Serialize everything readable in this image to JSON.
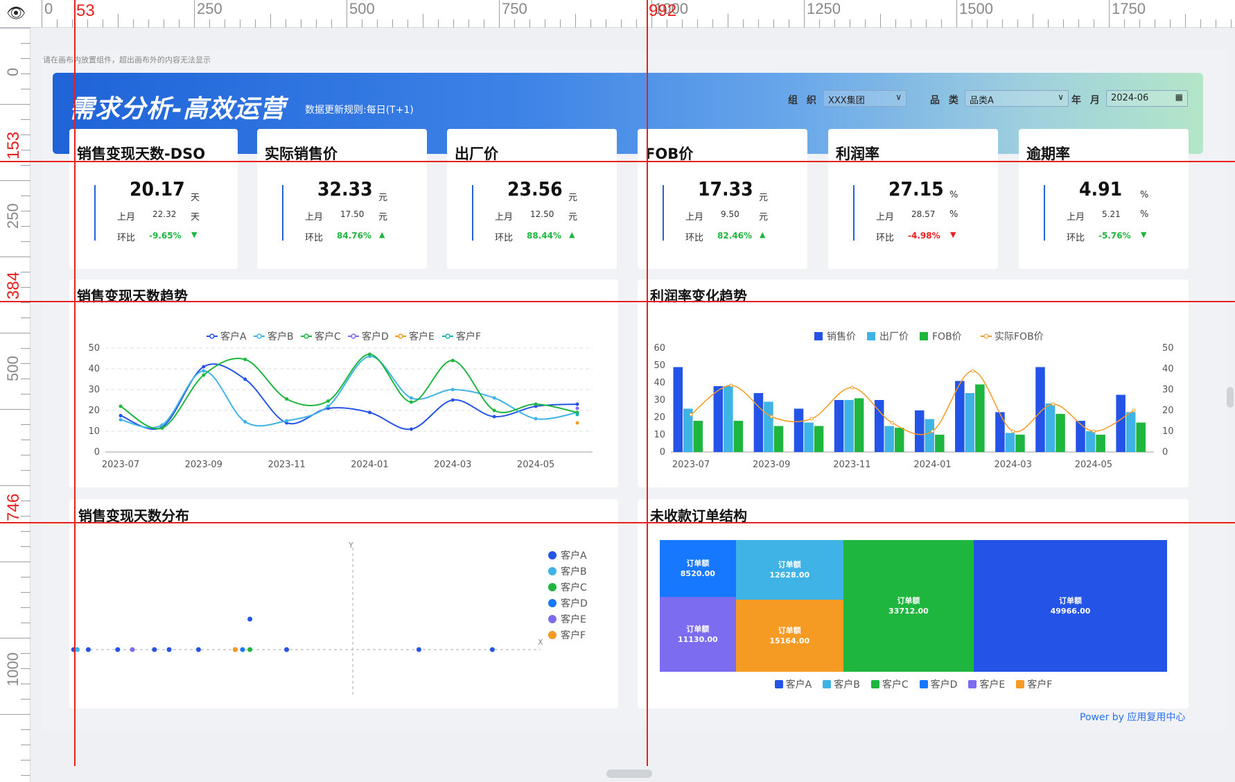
{
  "ruler": {
    "top_labels": [
      "0",
      "250",
      "500",
      "750",
      "1000",
      "1250",
      "1500",
      "1750"
    ],
    "left_labels": [
      "0",
      "250",
      "500",
      "1000"
    ],
    "guides_v": [
      "53",
      "992"
    ],
    "guides_h": [
      "153",
      "384",
      "746"
    ]
  },
  "canvas_note": "请在画布内放置组件，超出画布外的内容无法显示",
  "banner": {
    "title": "需求分析-高效运营",
    "subtitle": "数据更新规则:每日(T+1)",
    "filters": [
      {
        "label": "组 织",
        "value": "XXX集团",
        "control": "select"
      },
      {
        "label": "品 类",
        "value": "品类A",
        "control": "select"
      },
      {
        "label": "年 月",
        "value": "2024-06",
        "control": "date"
      }
    ]
  },
  "kpis": [
    {
      "title": "销售变现天数-DSO",
      "value": "20.17",
      "unit": "天",
      "prev_label": "上月",
      "prev": "22.32",
      "prev_unit": "天",
      "chg_label": "环比",
      "chg": "-9.65%",
      "direction": "down",
      "color": "#1fb640"
    },
    {
      "title": "实际销售价",
      "value": "32.33",
      "unit": "元",
      "prev_label": "上月",
      "prev": "17.50",
      "prev_unit": "元",
      "chg_label": "环比",
      "chg": "84.76%",
      "direction": "up",
      "color": "#1fb640"
    },
    {
      "title": "出厂价",
      "value": "23.56",
      "unit": "元",
      "prev_label": "上月",
      "prev": "12.50",
      "prev_unit": "元",
      "chg_label": "环比",
      "chg": "88.44%",
      "direction": "up",
      "color": "#1fb640"
    },
    {
      "title": "FOB价",
      "value": "17.33",
      "unit": "元",
      "prev_label": "上月",
      "prev": "9.50",
      "prev_unit": "元",
      "chg_label": "环比",
      "chg": "82.46%",
      "direction": "up",
      "color": "#1fb640"
    },
    {
      "title": "利润率",
      "value": "27.15",
      "unit": "%",
      "prev_label": "上月",
      "prev": "28.57",
      "prev_unit": "%",
      "chg_label": "环比",
      "chg": "-4.98%",
      "direction": "down",
      "color": "#e8201d"
    },
    {
      "title": "逾期率",
      "value": "4.91",
      "unit": "%",
      "prev_label": "上月",
      "prev": "5.21",
      "prev_unit": "%",
      "chg_label": "环比",
      "chg": "-5.76%",
      "direction": "down",
      "color": "#1fb640"
    }
  ],
  "panels": {
    "trend_dso": "销售变现天数趋势",
    "trend_profit": "利润率变化趋势",
    "dist": "销售变现天数分布",
    "structure": "未收款订单结构"
  },
  "powered_by": "Power by 应用复用中心",
  "chart_data": [
    {
      "type": "line",
      "title": "销售变现天数趋势",
      "x": [
        "2023-07",
        "2023-08",
        "2023-09",
        "2023-10",
        "2023-11",
        "2023-12",
        "2024-01",
        "2024-02",
        "2024-03",
        "2024-04",
        "2024-05",
        "2024-06"
      ],
      "x_ticks": [
        "2023-07",
        "2023-09",
        "2023-11",
        "2024-01",
        "2024-03",
        "2024-05"
      ],
      "ylim": [
        0,
        50
      ],
      "y_ticks": [
        "0",
        "10",
        "20",
        "30",
        "40",
        "50"
      ],
      "legend_position": "top",
      "colors": [
        "#2453e8",
        "#3fb2e6",
        "#1fb640",
        "#7b6cf0",
        "#f59a23",
        "#13b5b1"
      ],
      "series": [
        {
          "name": "客户A",
          "values": [
            17.5,
            12,
            41,
            35,
            14,
            21,
            19,
            11,
            25,
            17,
            22,
            23
          ]
        },
        {
          "name": "客户B",
          "values": [
            15.5,
            13,
            39,
            14.5,
            15,
            22,
            46,
            26,
            30,
            26,
            16,
            19
          ]
        },
        {
          "name": "客户C",
          "values": [
            22,
            11.5,
            37,
            44.5,
            25.5,
            24.5,
            47,
            24,
            44,
            20,
            23,
            19
          ]
        },
        {
          "name": "客户D",
          "values": [
            null,
            null,
            null,
            null,
            null,
            null,
            null,
            null,
            null,
            null,
            null,
            21
          ]
        },
        {
          "name": "客户E",
          "values": [
            null,
            null,
            null,
            null,
            null,
            null,
            null,
            null,
            null,
            null,
            null,
            14
          ]
        },
        {
          "name": "客户F",
          "values": [
            null,
            null,
            null,
            null,
            null,
            null,
            null,
            null,
            null,
            null,
            null,
            18
          ]
        }
      ]
    },
    {
      "type": "bar",
      "title": "利润率变化趋势",
      "x": [
        "2023-07",
        "2023-08",
        "2023-09",
        "2023-10",
        "2023-11",
        "2023-12",
        "2024-01",
        "2024-02",
        "2024-03",
        "2024-04",
        "2024-05",
        "2024-06"
      ],
      "x_ticks": [
        "2023-07",
        "2023-09",
        "2023-11",
        "2024-01",
        "2024-03",
        "2024-05"
      ],
      "ylim_left": [
        0,
        60
      ],
      "y_ticks_left": [
        "0",
        "10",
        "20",
        "30",
        "40",
        "50",
        "60"
      ],
      "ylim_right": [
        0,
        50
      ],
      "y_ticks_right": [
        "0",
        "10",
        "20",
        "30",
        "40",
        "50"
      ],
      "legend_position": "top",
      "colors": [
        "#2453e8",
        "#3fb2e6",
        "#1fb640",
        "#f59a23"
      ],
      "series": [
        {
          "name": "销售价",
          "kind": "bar",
          "values": [
            49,
            38,
            34,
            25,
            30,
            30,
            24,
            41,
            23,
            49,
            18,
            33
          ]
        },
        {
          "name": "出厂价",
          "kind": "bar",
          "values": [
            25,
            38,
            29,
            17,
            30,
            15,
            19,
            34,
            11,
            28,
            12,
            23
          ]
        },
        {
          "name": "FOB价",
          "kind": "bar",
          "values": [
            18,
            18,
            15,
            15,
            31,
            14,
            10,
            39,
            10,
            22,
            10,
            17
          ]
        },
        {
          "name": "实际FOB价",
          "kind": "line",
          "axis": "right",
          "values": [
            18,
            32,
            17,
            16,
            31,
            14,
            10,
            39,
            10,
            23,
            10,
            20
          ]
        }
      ]
    },
    {
      "type": "scatter",
      "title": "销售变现天数分布",
      "axis_x_label": "X",
      "axis_y_label": "Y",
      "legend_position": "right",
      "colors": [
        "#2453e8",
        "#3fb2e6",
        "#1fb640",
        "#1677ff",
        "#7b6cf0",
        "#f59a23"
      ],
      "series": [
        {
          "name": "客户A",
          "points": [
            [
              -38,
              0
            ],
            [
              -36,
              0
            ],
            [
              -32,
              0
            ],
            [
              -27,
              0
            ],
            [
              -25,
              0
            ],
            [
              -21,
              0
            ],
            [
              -16,
              0
            ],
            [
              -14,
              1
            ],
            [
              -13,
              4
            ],
            [
              -9,
              0
            ],
            [
              9,
              0
            ],
            [
              19,
              0
            ]
          ]
        },
        {
          "name": "客户B",
          "points": [
            [
              -37.5,
              0
            ]
          ]
        },
        {
          "name": "客户C",
          "points": [
            [
              -14,
              0
            ]
          ]
        },
        {
          "name": "客户D",
          "points": [
            [
              -15,
              0
            ]
          ]
        },
        {
          "name": "客户E",
          "points": [
            [
              -30,
              0
            ]
          ]
        },
        {
          "name": "客户F",
          "points": [
            [
              -16,
              0
            ]
          ]
        }
      ]
    },
    {
      "type": "treemap",
      "title": "未收款订单结构",
      "legend_position": "bottom",
      "colors": [
        "#2453e8",
        "#3fb2e6",
        "#1fb640",
        "#1677ff",
        "#7b6cf0",
        "#f59a23"
      ],
      "cell_label": "订单额",
      "series": [
        {
          "name": "客户A",
          "value": 49966.0
        },
        {
          "name": "客户B",
          "value": 12628.0
        },
        {
          "name": "客户C",
          "value": 33712.0
        },
        {
          "name": "客户D",
          "value": 8520.0
        },
        {
          "name": "客户E",
          "value": 11130.0
        },
        {
          "name": "客户F",
          "value": 15164.0
        }
      ]
    }
  ]
}
